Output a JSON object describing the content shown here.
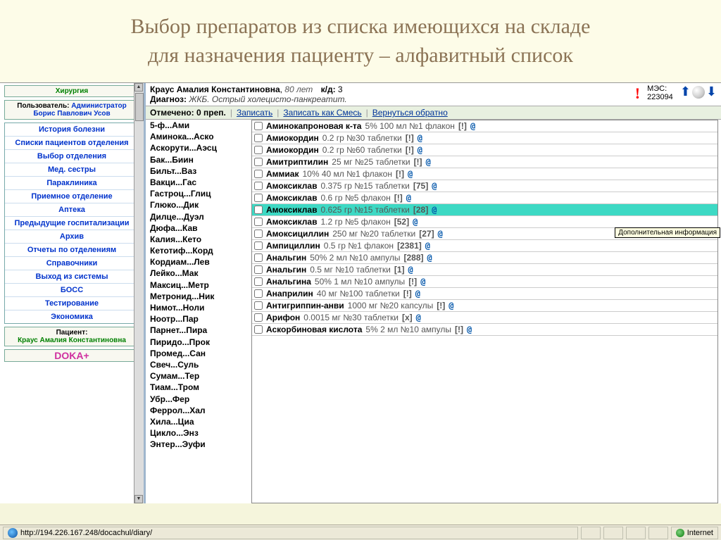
{
  "slide_title_l1": "Выбор препаратов из списка имеющихся на складе",
  "slide_title_l2": "для назначения пациенту – алфавитный список",
  "sidebar": {
    "department": "Хирургия",
    "user_label": "Пользователь:",
    "user_value": "Администратор Борис Павлович Усов",
    "nav": [
      "История болезни",
      "Списки пациентов отделения",
      "Выбор отделения",
      "Мед. сестры",
      "Параклиника",
      "Приемное отделение",
      "Аптека",
      "Предыдущие госпитализации",
      "Архив",
      "Отчеты по отделениям",
      "Справочники",
      "Выход из системы",
      "БОСС",
      "Тестирование",
      "Экономика"
    ],
    "patient_label": "Пациент:",
    "patient_name": "Краус Амалия Константиновна",
    "doka": "DOKA+"
  },
  "patinfo": {
    "name": "Краус Амалия Константиновна",
    "age": "80 лет",
    "kd_label": "к/д:",
    "kd_value": "3",
    "diag_label": "Диагноз:",
    "diag_value": "ЖКБ. Острый холецисто-панкреатит.",
    "mes_label": "МЭС:",
    "mes_value": "223094"
  },
  "actions": {
    "count": "Отмечено: 0 преп.",
    "save": "Записать",
    "save_mix": "Записать как Смесь",
    "back": "Вернуться обратно"
  },
  "alpha": [
    "5-ф...Ами",
    "Аминока...Аско",
    "Аскорути...Аэсц",
    "Бак...Биин",
    "Бильт...Ваз",
    "Вакци...Гас",
    "Гастроц...Глиц",
    "Глюко...Дик",
    "Дилце...Дуэл",
    "Дюфа...Кав",
    "Калия...Кето",
    "Кетотиф...Корд",
    "Кордиам...Лев",
    "Лейко...Мак",
    "Максиц...Метр",
    "Метронид...Ник",
    "Нимот...Ноли",
    "Ноотр...Пар",
    "Парнет...Пира",
    "Пиридо...Прок",
    "Промед...Сан",
    "Свеч...Суль",
    "Сумам...Тер",
    "Тиам...Тром",
    "Убр...Фер",
    "Феррол...Хал",
    "Хила...Циа",
    "Цикло...Энз",
    "Энтер...Эуфи"
  ],
  "tooltip": "Дополнительная информация",
  "drugs": [
    {
      "name": "Аминокапроновая к-та",
      "rest": "5% 100 мл №1 флакон",
      "flag": "[!]",
      "hi": false
    },
    {
      "name": "Амиокордин",
      "rest": "0.2 гр №30 таблетки",
      "flag": "[!]",
      "hi": false
    },
    {
      "name": "Амиокордин",
      "rest": "0.2 гр №60 таблетки",
      "flag": "[!]",
      "hi": false
    },
    {
      "name": "Амитриптилин",
      "rest": "25 мг №25 таблетки",
      "flag": "[!]",
      "hi": false
    },
    {
      "name": "Аммиак",
      "rest": "10% 40 мл №1 флакон",
      "flag": "[!]",
      "hi": false
    },
    {
      "name": "Амоксиклав",
      "rest": "0.375 гр №15 таблетки",
      "flag": "[75]",
      "hi": false
    },
    {
      "name": "Амоксиклав",
      "rest": "0.6 гр №5 флакон",
      "flag": "[!]",
      "hi": false
    },
    {
      "name": "Амоксиклав",
      "rest": "0.625 гр №15 таблетки",
      "flag": "[28]",
      "hi": true
    },
    {
      "name": "Амоксиклав",
      "rest": "1.2 гр №5 флакон",
      "flag": "[52]",
      "hi": false
    },
    {
      "name": "Амоксициллин",
      "rest": "250 мг №20 таблетки",
      "flag": "[27]",
      "hi": false
    },
    {
      "name": "Ампициллин",
      "rest": "0.5 гр №1 флакон",
      "flag": "[2381]",
      "hi": false
    },
    {
      "name": "Анальгин",
      "rest": "50% 2 мл №10 ампулы",
      "flag": "[288]",
      "hi": false
    },
    {
      "name": "Анальгин",
      "rest": "0.5 мг №10 таблетки",
      "flag": "[1]",
      "hi": false
    },
    {
      "name": "Анальгина",
      "rest": "50% 1 мл №10 ампулы",
      "flag": "[!]",
      "hi": false
    },
    {
      "name": "Анаприлин",
      "rest": "40 мг №100 таблетки",
      "flag": "[!]",
      "hi": false
    },
    {
      "name": "Антигриппин-анви",
      "rest": "1000 мг №20 капсулы",
      "flag": "[!]",
      "hi": false
    },
    {
      "name": "Арифон",
      "rest": "0.0015 мг №30 таблетки",
      "flag": "[x]",
      "hi": false
    },
    {
      "name": "Аскорбиновая кислота",
      "rest": "5% 2 мл №10 ампулы",
      "flag": "[!]",
      "hi": false
    }
  ],
  "status": {
    "url": "http://194.226.167.248/docachul/diary/",
    "zone": "Internet"
  }
}
